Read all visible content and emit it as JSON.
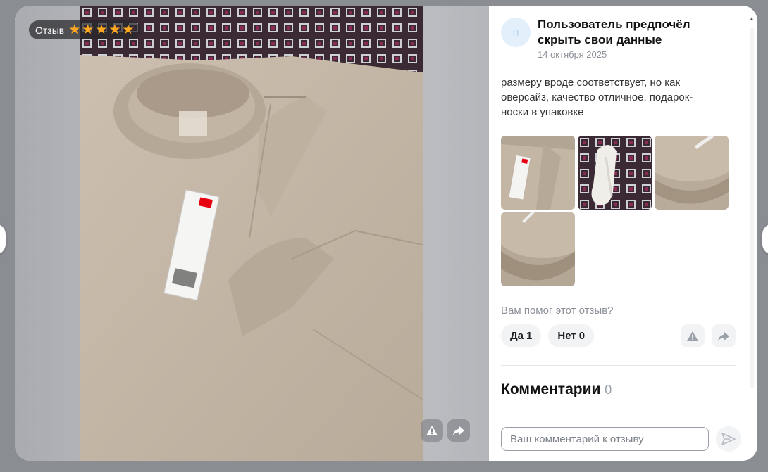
{
  "review": {
    "chip_label": "Отзыв",
    "rating": 5,
    "author": "Пользователь предпочёл скрыть свои данные",
    "avatar_letter": "п",
    "date": "14 октября 2025",
    "text": "размеру вроде соответствует, но как оверсайз, качество отличное. подарок-носки в упаковке"
  },
  "thumbnails": [
    "tshirt-with-tag",
    "white-socks",
    "collar-print-closeup",
    "collar-closeup"
  ],
  "feedback": {
    "question": "Вам помог этот отзыв?",
    "yes_label": "Да",
    "yes_count": "1",
    "no_label": "Нет",
    "no_count": "0"
  },
  "comments": {
    "title": "Комментарии",
    "count": "0",
    "input_placeholder": "Ваш комментарий к отзыву"
  },
  "icons": {
    "report": "report-warning-icon",
    "share": "share-icon",
    "send": "send-icon"
  },
  "colors": {
    "star": "#ffa81f",
    "fabric": "#c6b8a8"
  }
}
